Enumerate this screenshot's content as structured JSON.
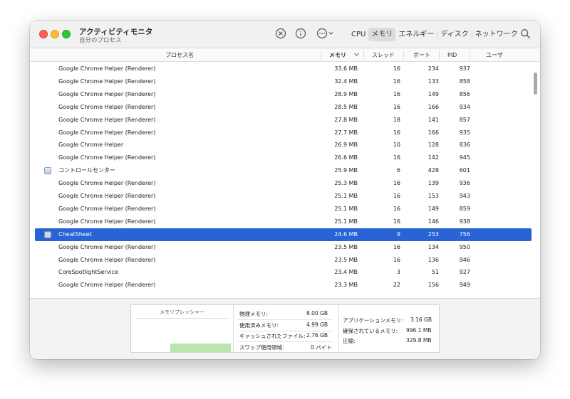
{
  "window": {
    "title": "アクティビティモニタ",
    "subtitle": "自分のプロセス"
  },
  "toolbar": {
    "icons": [
      "stop-process-icon",
      "info-icon",
      "more-options-icon",
      "search-icon"
    ],
    "tabs": [
      "CPU",
      "メモリ",
      "エネルギー",
      "ディスク",
      "ネットワーク"
    ],
    "active_tab": "メモリ"
  },
  "columns": {
    "process_name": "プロセス名",
    "memory": "メモリ",
    "threads": "スレッド",
    "ports": "ポート",
    "pid": "PID",
    "user": "ユーザ"
  },
  "rows": [
    {
      "name": "Google Chrome Helper (Renderer)",
      "mem": "33.6 MB",
      "threads": "16",
      "ports": "234",
      "pid": "937"
    },
    {
      "name": "Google Chrome Helper (Renderer)",
      "mem": "32.4 MB",
      "threads": "16",
      "ports": "133",
      "pid": "858"
    },
    {
      "name": "Google Chrome Helper (Renderer)",
      "mem": "28.9 MB",
      "threads": "16",
      "ports": "149",
      "pid": "856"
    },
    {
      "name": "Google Chrome Helper (Renderer)",
      "mem": "28.5 MB",
      "threads": "16",
      "ports": "166",
      "pid": "934"
    },
    {
      "name": "Google Chrome Helper (Renderer)",
      "mem": "27.8 MB",
      "threads": "18",
      "ports": "141",
      "pid": "857"
    },
    {
      "name": "Google Chrome Helper (Renderer)",
      "mem": "27.7 MB",
      "threads": "16",
      "ports": "166",
      "pid": "935"
    },
    {
      "name": "Google Chrome Helper",
      "mem": "26.9 MB",
      "threads": "10",
      "ports": "128",
      "pid": "836"
    },
    {
      "name": "Google Chrome Helper (Renderer)",
      "mem": "26.6 MB",
      "threads": "16",
      "ports": "142",
      "pid": "945"
    },
    {
      "name": "コントロールセンター",
      "mem": "25.9 MB",
      "threads": "6",
      "ports": "428",
      "pid": "601",
      "icon": "control-center-icon"
    },
    {
      "name": "Google Chrome Helper (Renderer)",
      "mem": "25.3 MB",
      "threads": "16",
      "ports": "139",
      "pid": "936"
    },
    {
      "name": "Google Chrome Helper (Renderer)",
      "mem": "25.1 MB",
      "threads": "16",
      "ports": "153",
      "pid": "943"
    },
    {
      "name": "Google Chrome Helper (Renderer)",
      "mem": "25.1 MB",
      "threads": "16",
      "ports": "149",
      "pid": "859"
    },
    {
      "name": "Google Chrome Helper (Renderer)",
      "mem": "25.1 MB",
      "threads": "16",
      "ports": "146",
      "pid": "938"
    },
    {
      "name": "CheatSheet",
      "mem": "24.6 MB",
      "threads": "9",
      "ports": "253",
      "pid": "756",
      "icon": "cheatsheet-icon",
      "selected": true
    },
    {
      "name": "Google Chrome Helper (Renderer)",
      "mem": "23.5 MB",
      "threads": "16",
      "ports": "134",
      "pid": "950"
    },
    {
      "name": "Google Chrome Helper (Renderer)",
      "mem": "23.5 MB",
      "threads": "16",
      "ports": "136",
      "pid": "946"
    },
    {
      "name": "CoreSpotlightService",
      "mem": "23.4 MB",
      "threads": "3",
      "ports": "51",
      "pid": "927"
    },
    {
      "name": "Google Chrome Helper (Renderer)",
      "mem": "23.3 MB",
      "threads": "22",
      "ports": "156",
      "pid": "949"
    }
  ],
  "memory_summary": {
    "pressure_title": "メモリプレッシャー",
    "pressure_level": 0.15,
    "physical_label": "物理メモリ:",
    "physical_value": "8.00 GB",
    "used_label": "使用済みメモリ:",
    "used_value": "4.99 GB",
    "cached_label": "キャッシュされたファイル:",
    "cached_value": "2.76 GB",
    "swap_label": "スワップ使用領域:",
    "swap_value": "0 バイト",
    "app_label": "アプリケーションメモリ:",
    "app_value": "3.16 GB",
    "wired_label": "確保されているメモリ:",
    "wired_value": "996.1 MB",
    "compressed_label": "圧縮:",
    "compressed_value": "329.8 MB"
  },
  "colors": {
    "selection": "#2864d6",
    "pressure_green": "#b8e6ad"
  }
}
